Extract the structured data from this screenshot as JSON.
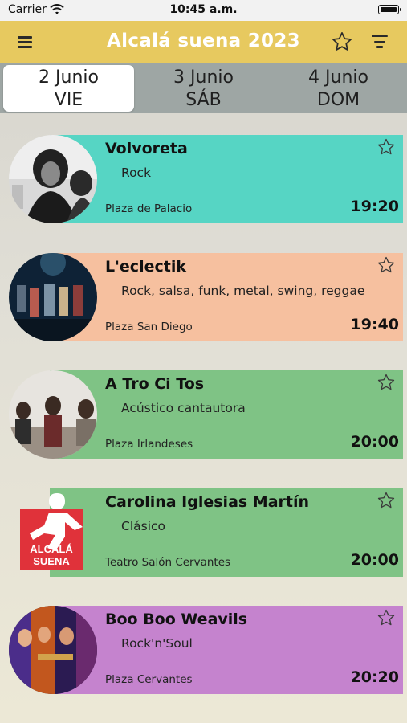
{
  "status_bar": {
    "carrier": "Carrier",
    "time": "10:45 a.m."
  },
  "nav": {
    "title": "Alcalá suena 2023",
    "icons": [
      "menu-icon",
      "star-outline-icon",
      "filter-icon"
    ]
  },
  "tabs": [
    {
      "date": "2 Junio",
      "weekday": "VIE",
      "selected": true
    },
    {
      "date": "3 Junio",
      "weekday": "SÁB",
      "selected": false
    },
    {
      "date": "4 Junio",
      "weekday": "DOM",
      "selected": false
    }
  ],
  "events": [
    {
      "name": "Volvoreta",
      "genre": "Rock",
      "venue": "Plaza de Palacio",
      "time": "19:20",
      "color": "#56d5c4"
    },
    {
      "name": "L'eclectik",
      "genre": "Rock, salsa, funk, metal, swing, reggae",
      "venue": "Plaza San Diego",
      "time": "19:40",
      "color": "#f6c09f"
    },
    {
      "name": "A Tro Ci Tos",
      "genre": "Acústico cantautora",
      "venue": "Plaza Irlandeses",
      "time": "20:00",
      "color": "#7fc385"
    },
    {
      "name": "Carolina Iglesias Martín",
      "genre": "Clásico",
      "venue": "Teatro Salón Cervantes",
      "time": "20:00",
      "color": "#7fc385",
      "logo_text": [
        "ALCALÁ",
        "SUENA"
      ]
    },
    {
      "name": "Boo Boo Weavils",
      "genre": "Rock'n'Soul",
      "venue": "Plaza Cervantes",
      "time": "20:20",
      "color": "#c583ce"
    }
  ]
}
